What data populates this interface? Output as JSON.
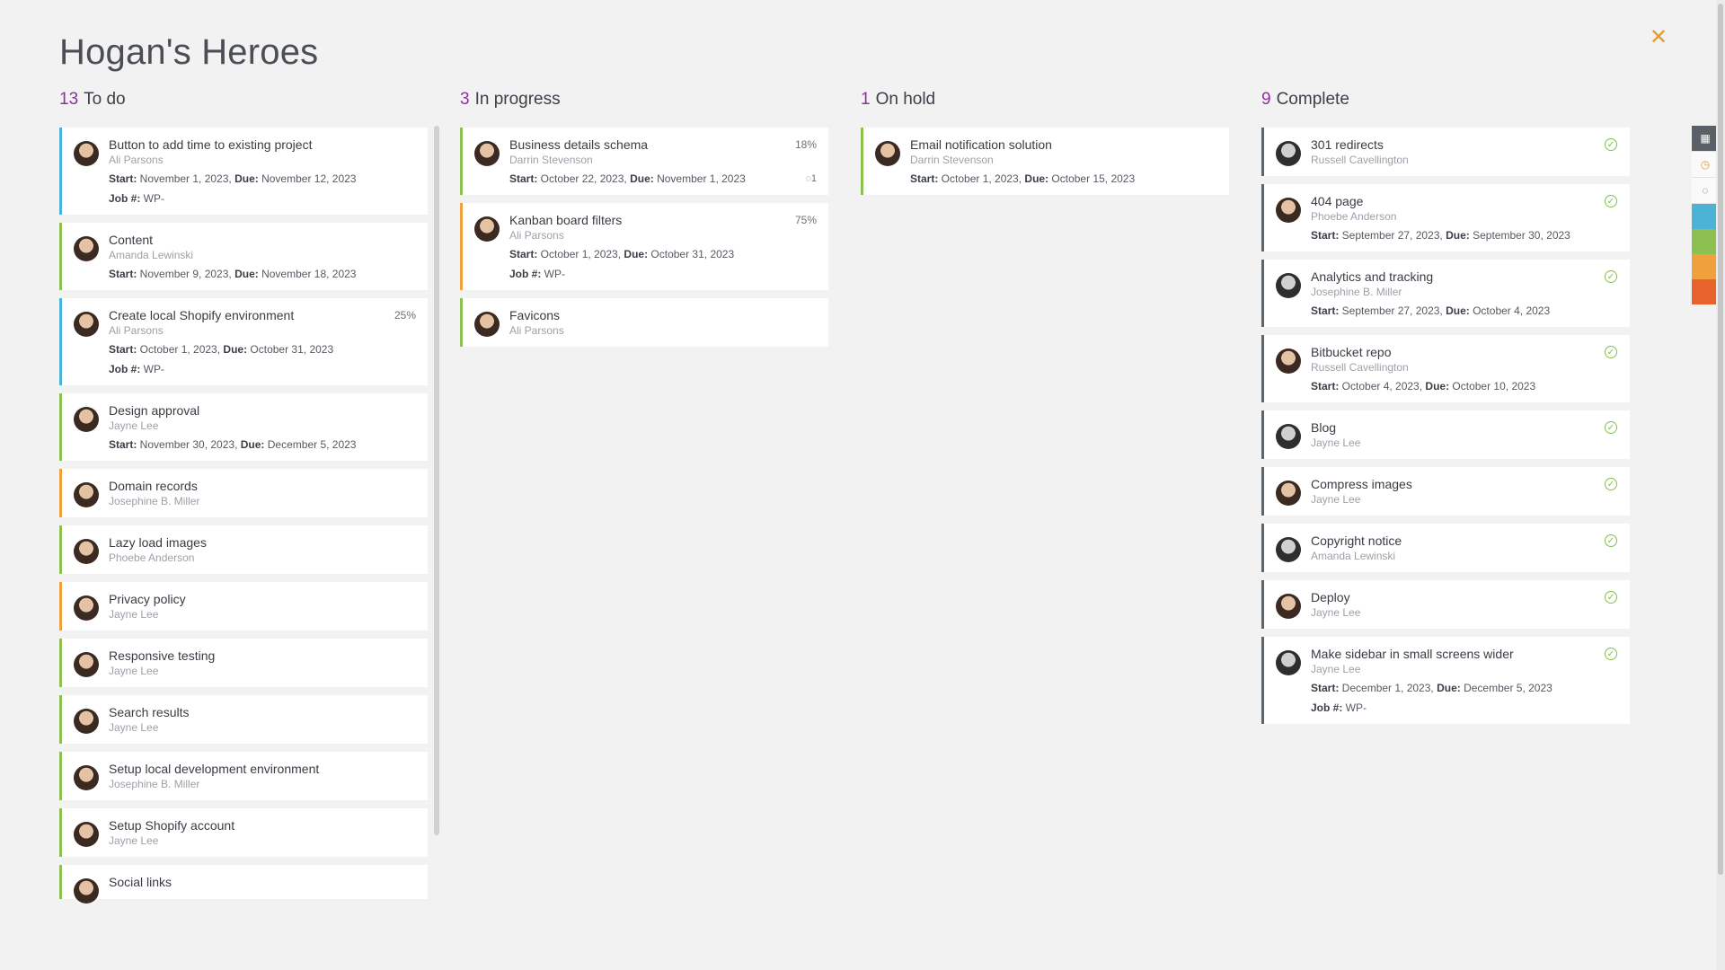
{
  "board": {
    "title": "Hogan's Heroes"
  },
  "colors": {
    "accent_count": "#8e2fa0",
    "close": "#e39a2b",
    "check": "#7fc245"
  },
  "labels": {
    "start": "Start:",
    "due": "Due:",
    "job": "Job #:"
  },
  "columns": [
    {
      "count": "13",
      "label": "To do",
      "cards": [
        {
          "name": "Button to add time to existing project",
          "who": "Ali Parsons",
          "start": "November 1, 2023,",
          "due": "November 12, 2023",
          "job": "WP-",
          "stripe": "#4db3d4"
        },
        {
          "name": "Content",
          "who": "Amanda Lewinski",
          "start": "November 9, 2023,",
          "due": "November 18, 2023",
          "stripe": "#8cc152"
        },
        {
          "name": "Create local Shopify environment",
          "who": "Ali Parsons",
          "start": "October 1, 2023,",
          "due": "October 31, 2023",
          "job": "WP-",
          "pct": "25%",
          "stripe": "#4db3d4"
        },
        {
          "name": "Design approval",
          "who": "Jayne Lee",
          "start": "November 30, 2023,",
          "due": "December 5, 2023",
          "stripe": "#8cc152"
        },
        {
          "name": "Domain records",
          "who": "Josephine B. Miller",
          "stripe": "#f0a03c"
        },
        {
          "name": "Lazy load images",
          "who": "Phoebe Anderson",
          "stripe": "#8cc152"
        },
        {
          "name": "Privacy policy",
          "who": "Jayne Lee",
          "stripe": "#f0a03c"
        },
        {
          "name": "Responsive testing",
          "who": "Jayne Lee",
          "stripe": "#8cc152"
        },
        {
          "name": "Search results",
          "who": "Jayne Lee",
          "stripe": "#8cc152"
        },
        {
          "name": "Setup local development environment",
          "who": "Josephine B. Miller",
          "stripe": "#8cc152"
        },
        {
          "name": "Setup Shopify account",
          "who": "Jayne Lee",
          "stripe": "#8cc152"
        },
        {
          "name": "Social links",
          "who": "",
          "stripe": "#8cc152"
        }
      ]
    },
    {
      "count": "3",
      "label": "In progress",
      "cards": [
        {
          "name": "Business details schema",
          "who": "Darrin Stevenson",
          "start": "October 22, 2023,",
          "due": "November 1, 2023",
          "pct": "18%",
          "comments": "1",
          "stripe": "#8cc152"
        },
        {
          "name": "Kanban board filters",
          "who": "Ali Parsons",
          "start": "October 1, 2023,",
          "due": "October 31, 2023",
          "job": "WP-",
          "pct": "75%",
          "stripe": "#f0a03c"
        },
        {
          "name": "Favicons",
          "who": "Ali Parsons",
          "stripe": "#8cc152"
        }
      ]
    },
    {
      "count": "1",
      "label": "On hold",
      "cards": [
        {
          "name": "Email notification solution",
          "who": "Darrin Stevenson",
          "start": "October 1, 2023,",
          "due": "October 15, 2023",
          "stripe": "#8cc152"
        }
      ]
    },
    {
      "count": "9",
      "label": "Complete",
      "cards": [
        {
          "name": "301 redirects",
          "who": "Russell Cavellington",
          "done": true,
          "stripe": "#5f6469"
        },
        {
          "name": "404 page",
          "who": "Phoebe Anderson",
          "start": "September 27, 2023,",
          "due": "September 30, 2023",
          "done": true,
          "stripe": "#5f6469"
        },
        {
          "name": "Analytics and tracking",
          "who": "Josephine B. Miller",
          "start": "September 27, 2023,",
          "due": "October 4, 2023",
          "done": true,
          "stripe": "#5f6469"
        },
        {
          "name": "Bitbucket repo",
          "who": "Russell Cavellington",
          "start": "October 4, 2023,",
          "due": "October 10, 2023",
          "done": true,
          "stripe": "#5f6469"
        },
        {
          "name": "Blog",
          "who": "Jayne Lee",
          "done": true,
          "stripe": "#5f6469"
        },
        {
          "name": "Compress images",
          "who": "Jayne Lee",
          "done": true,
          "stripe": "#5f6469"
        },
        {
          "name": "Copyright notice",
          "who": "Amanda Lewinski",
          "done": true,
          "stripe": "#5f6469"
        },
        {
          "name": "Deploy",
          "who": "Jayne Lee",
          "done": true,
          "stripe": "#5f6469"
        },
        {
          "name": "Make sidebar in small screens wider",
          "who": "Jayne Lee",
          "start": "December 1, 2023,",
          "due": "December 5, 2023",
          "job": "WP-",
          "done": true,
          "stripe": "#5f6469"
        }
      ]
    }
  ],
  "rail": {
    "buttons": [
      {
        "icon": "grid-icon"
      },
      {
        "icon": "clock-icon"
      },
      {
        "icon": "comment-icon"
      }
    ],
    "swatches": [
      "#4db3d4",
      "#8cc152",
      "#f0a03c",
      "#e8632b"
    ]
  }
}
